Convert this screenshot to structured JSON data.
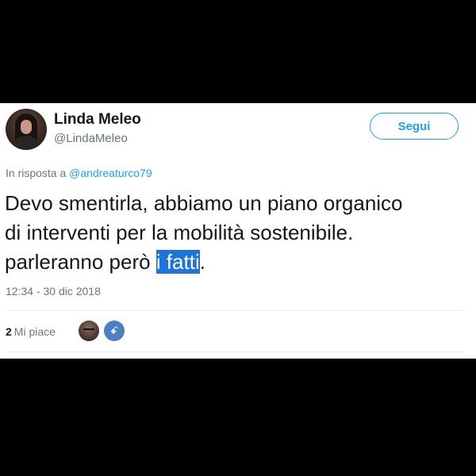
{
  "user": {
    "display_name": "Linda Meleo",
    "handle": "@LindaMeleo"
  },
  "follow_button": {
    "label": "Segui"
  },
  "reply_context": {
    "prefix": "In risposta a ",
    "mention": "@andreaturco79"
  },
  "tweet": {
    "line1": "Devo smentirla, abbiamo un piano organico",
    "line2": "di interventi per la mobilità sostenibile.",
    "line3_before": "parleranno però ",
    "line3_highlight": "i fatti",
    "line3_after": "."
  },
  "timestamp": "12:34 - 30 dic 2018",
  "likes": {
    "count": "2",
    "label": "Mi piace"
  },
  "liker_two_glyph": "ꗃ",
  "colors": {
    "accent": "#1da1f2",
    "selection": "#1e73dc",
    "muted": "#657786"
  },
  "icons": [
    "avatar-image",
    "liker-avatar",
    "liker-avatar"
  ]
}
